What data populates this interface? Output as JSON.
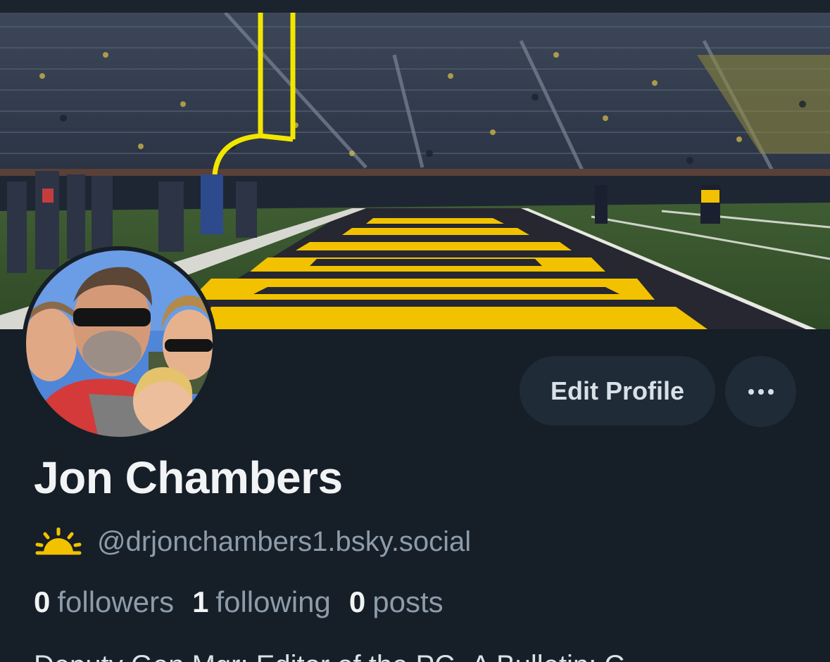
{
  "profile": {
    "display_name": "Jon Chambers",
    "handle": "@drjonchambers1.bsky.social",
    "bio_partial": "Deputy Gen Mgr; Editor of the PC~A Bulletin; C",
    "banner_image": "football-stadium-endzone-photo",
    "avatar_image": "family-selfie-photo"
  },
  "actions": {
    "edit_profile_label": "Edit Profile",
    "more_icon": "ellipsis-icon"
  },
  "stats": {
    "followers_count": "0",
    "followers_label": "followers",
    "following_count": "1",
    "following_label": "following",
    "posts_count": "0",
    "posts_label": "posts"
  },
  "icons": {
    "handle_badge": "sunrise-icon"
  },
  "colors": {
    "background": "#161e27",
    "button_background": "#1f2b37",
    "name_text": "#f1f3f5",
    "secondary_text": "#8d9cab",
    "accent_yellow": "#f2c200"
  }
}
